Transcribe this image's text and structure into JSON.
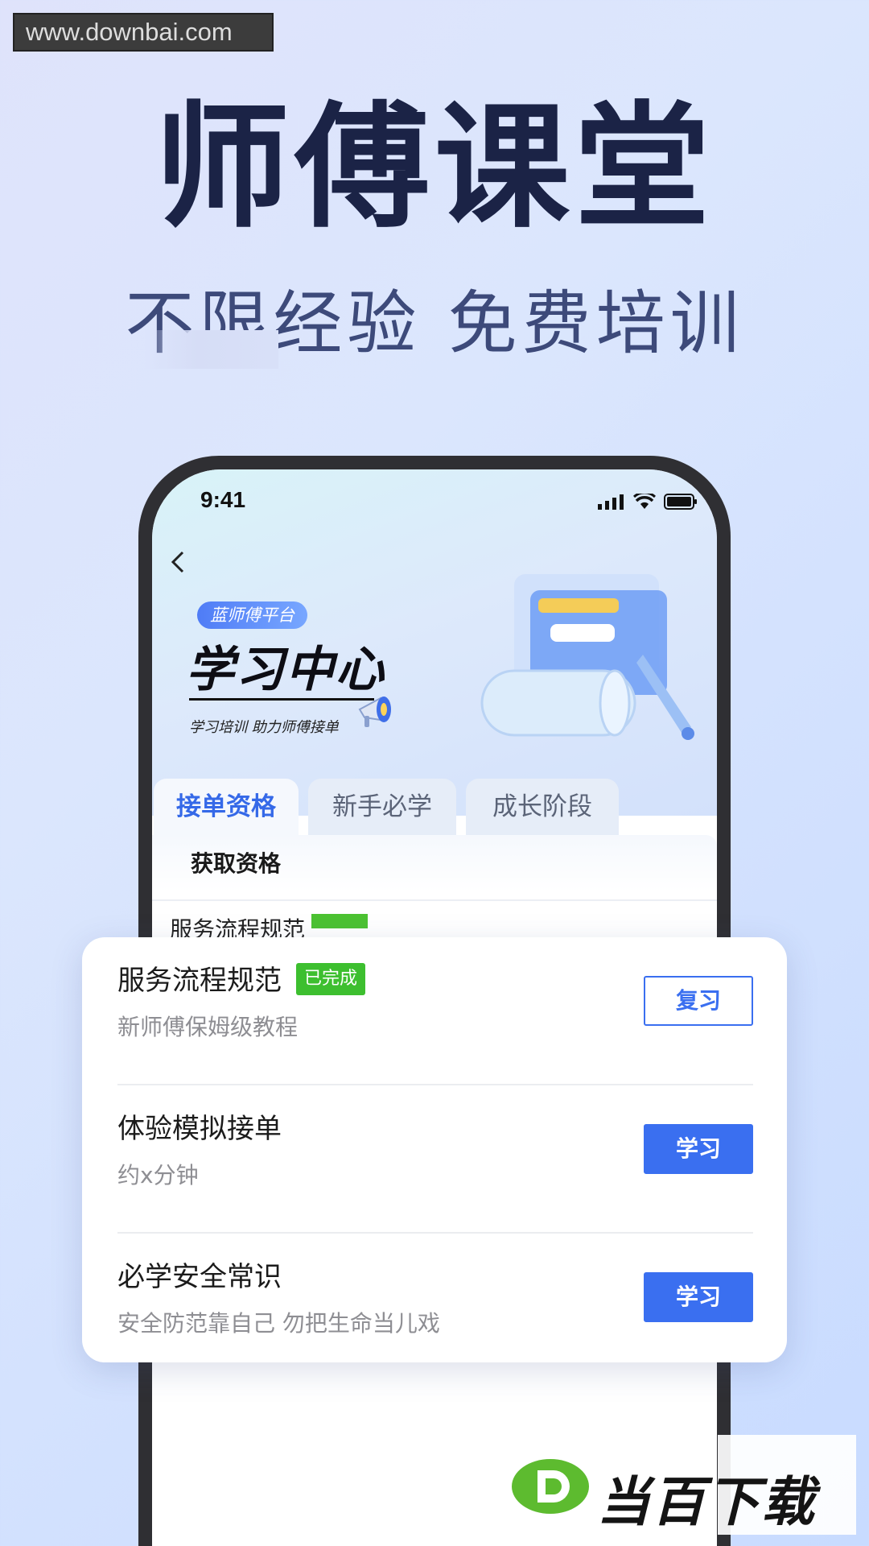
{
  "watermark": "www.downbai.com",
  "headline": "师傅课堂",
  "subheadline": "不限经验 免费培训",
  "status_bar": {
    "time": "9:41"
  },
  "hero": {
    "platform": "蓝师傅平台",
    "title": "学习中心",
    "slogan": "学习培训 助力师傅接单"
  },
  "tabs": [
    {
      "label": "接单资格",
      "active": true
    },
    {
      "label": "新手必学",
      "active": false
    },
    {
      "label": "成长阶段",
      "active": false
    }
  ],
  "section_title": "获取资格",
  "courses": [
    {
      "title": "服务流程规范",
      "badge": "已完成",
      "desc": "新师傅保姆级教程",
      "button": "复习",
      "style": "outline"
    },
    {
      "title": "体验模拟接单",
      "badge": "",
      "desc": "约x分钟",
      "button": "学习",
      "style": "solid"
    },
    {
      "title": "必学安全常识",
      "badge": "",
      "desc": "安全防范靠自己 勿把生命当儿戏",
      "button": "学习",
      "style": "solid"
    }
  ],
  "bottom_logo": {
    "text": "当百下载"
  },
  "colors": {
    "accent": "#3a6ff0",
    "done_badge": "#3dbf2f",
    "headline": "#1b2346"
  },
  "icons": [
    "back-chevron-icon",
    "signal-icon",
    "wifi-icon",
    "battery-icon",
    "megaphone-icon"
  ]
}
